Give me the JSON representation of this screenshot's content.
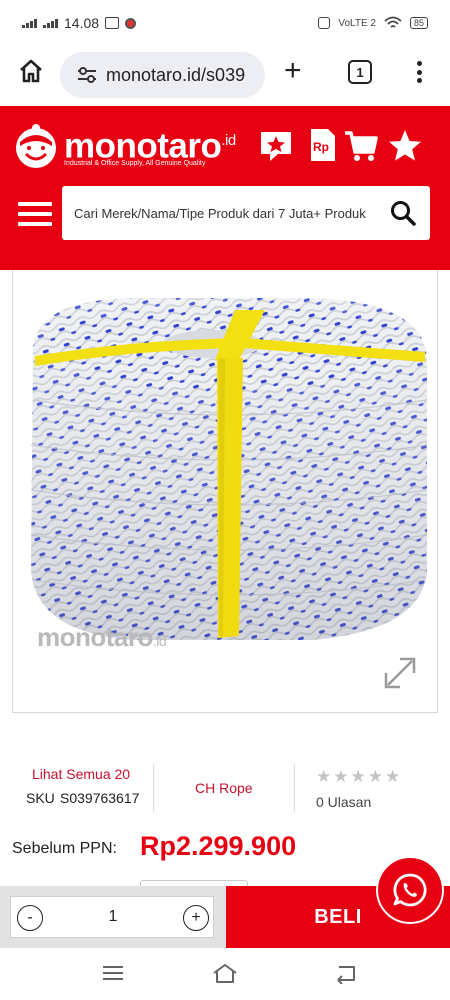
{
  "status_bar": {
    "time": "14.08",
    "network": "VoLTE 2",
    "battery": "85"
  },
  "browser": {
    "url": "monotaro.id/s039",
    "tab_count": "1"
  },
  "site": {
    "logo_name": "monotaro",
    "logo_suffix": ".id",
    "tagline": "Industrial & Office Supply, All Genuine Quality",
    "rp_label": "Rp",
    "search_placeholder": "Cari Merek/Nama/Tipe Produk dari 7 Juta+ Produk"
  },
  "product": {
    "watermark_name": "monotaro",
    "watermark_suffix": ".id",
    "see_all": "Lihat Semua 20",
    "sku_label": "SKU",
    "sku_value": "S039763617",
    "brand": "CH Rope",
    "rating_stars": 0,
    "reviews": "0 Ulasan",
    "price_label": "Sebelum PPN:",
    "price": "Rp2.299.900"
  },
  "purchase": {
    "minus": "-",
    "quantity": "1",
    "plus": "+",
    "buy_label": "BELI"
  },
  "colors": {
    "brand_red": "#e60012",
    "link_red": "#c8102e",
    "rope_blue": "#2c3fd1",
    "strap_yellow": "#f2e013"
  }
}
